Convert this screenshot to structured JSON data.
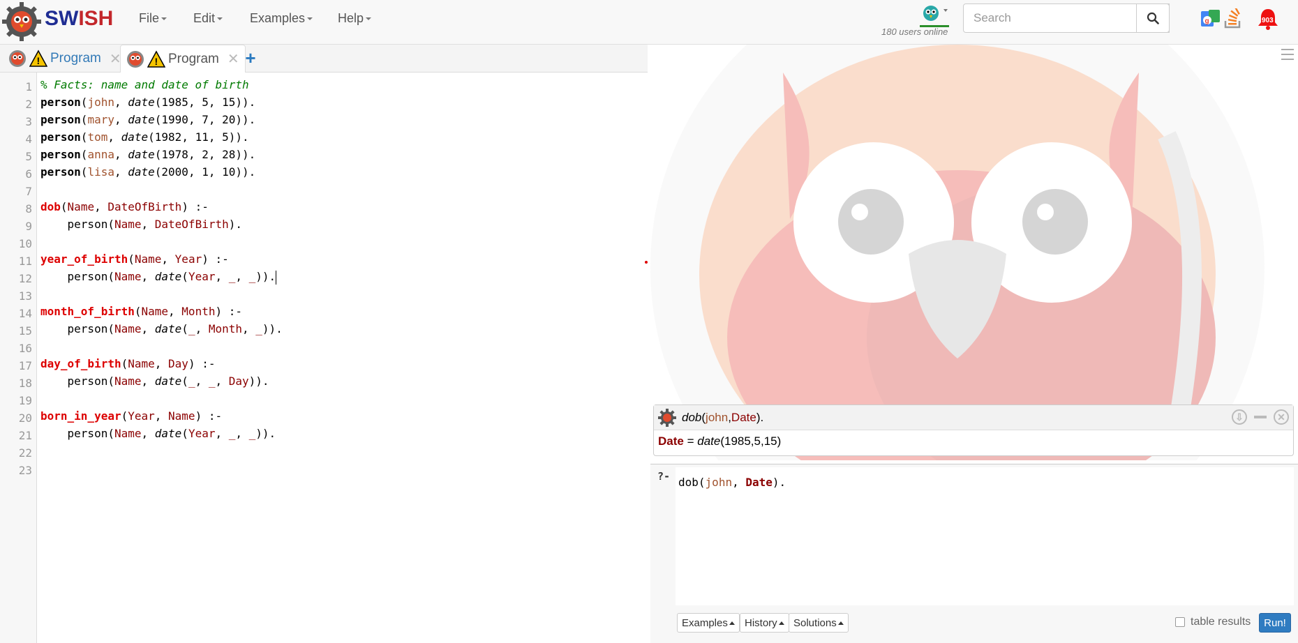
{
  "app": {
    "brand_part1": "SW",
    "brand_part2": "I",
    "brand_part3": "SH"
  },
  "menu": {
    "file": "File",
    "edit": "Edit",
    "examples": "Examples",
    "help": "Help"
  },
  "header": {
    "users_online": "180 users online",
    "search_placeholder": "Search",
    "notification_count": "903"
  },
  "tabs": [
    {
      "label": "Program",
      "close": "✕"
    },
    {
      "label": "Program",
      "close": "✕"
    }
  ],
  "editor": {
    "line_numbers": [
      "1",
      "2",
      "3",
      "4",
      "5",
      "6",
      "7",
      "8",
      "9",
      "10",
      "11",
      "12",
      "13",
      "14",
      "15",
      "16",
      "17",
      "18",
      "19",
      "20",
      "21",
      "22",
      "23"
    ],
    "l1": "% Facts: name and date of birth",
    "facts": [
      {
        "name": "john",
        "y": "1985",
        "m": "5",
        "d": "15"
      },
      {
        "name": "mary",
        "y": "1990",
        "m": "7",
        "d": "20"
      },
      {
        "name": "tom",
        "y": "1982",
        "m": "11",
        "d": "5"
      },
      {
        "name": "anna",
        "y": "1978",
        "m": "2",
        "d": "28"
      },
      {
        "name": "lisa",
        "y": "2000",
        "m": "1",
        "d": "10"
      }
    ],
    "head_person": "person",
    "fn_date": "date",
    "rules": {
      "dob": "dob",
      "year_of_birth": "year_of_birth",
      "month_of_birth": "month_of_birth",
      "day_of_birth": "day_of_birth",
      "born_in_year": "born_in_year"
    },
    "vars": {
      "name": "Name",
      "dob": "DateOfBirth",
      "year": "Year",
      "month": "Month",
      "day": "Day",
      "anon": "_"
    }
  },
  "results": {
    "query_fn": "dob",
    "query_atom": "john",
    "query_var": "Date",
    "answer_var": "Date",
    "answer_eq": " = ",
    "answer_fn": "date",
    "answer_args": "(1985,5,15)",
    "download_icon": "⇩",
    "close_icon": "✕"
  },
  "query": {
    "prompt": "?-",
    "fn": "dob",
    "atom": "john",
    "var": "Date",
    "examples_btn": "Examples",
    "history_btn": "History",
    "solutions_btn": "Solutions",
    "table_results": "table results",
    "run_btn": "Run!"
  }
}
